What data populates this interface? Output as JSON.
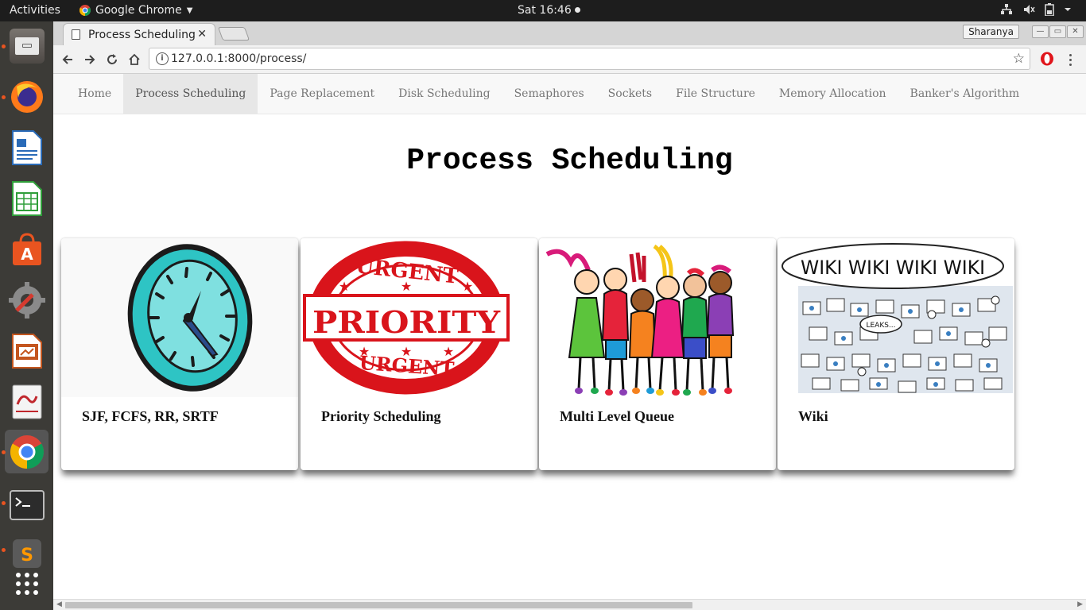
{
  "topbar": {
    "activities": "Activities",
    "app_name": "Google Chrome",
    "clock": "Sat 16:46"
  },
  "dock": {
    "items": [
      {
        "name": "files-icon"
      },
      {
        "name": "firefox-icon"
      },
      {
        "name": "writer-icon"
      },
      {
        "name": "calc-icon"
      },
      {
        "name": "software-center-icon"
      },
      {
        "name": "settings-icon"
      },
      {
        "name": "impress-icon"
      },
      {
        "name": "evince-icon"
      },
      {
        "name": "chrome-icon"
      },
      {
        "name": "terminal-icon"
      },
      {
        "name": "sublime-icon"
      },
      {
        "name": "app-grid-icon"
      }
    ]
  },
  "browser": {
    "tab_title": "Process Scheduling",
    "profile": "Sharanya",
    "url": "127.0.0.1:8000/process/"
  },
  "nav": {
    "links": [
      "Home",
      "Process Scheduling",
      "Page Replacement",
      "Disk Scheduling",
      "Semaphores",
      "Sockets",
      "File Structure",
      "Memory Allocation",
      "Banker's Algorithm"
    ],
    "active_index": 1
  },
  "page": {
    "title": "Process Scheduling",
    "cards": [
      {
        "caption": "SJF, FCFS, RR, SRTF"
      },
      {
        "caption": "Priority Scheduling",
        "stamp_top": "URGENT",
        "stamp_main": "PRIORITY",
        "stamp_bottom": "URGENT"
      },
      {
        "caption": "Multi Level Queue"
      },
      {
        "caption": "Wiki",
        "cloud_text": "WIKI WIKI WIKI WIKI",
        "bubble_text": "LEAKS..."
      }
    ]
  },
  "colors": {
    "clock_teal": "#2ec4c4",
    "stamp_red": "#d9141b",
    "nav_bg": "#f8f8f8",
    "nav_active": "#e7e7e7"
  }
}
